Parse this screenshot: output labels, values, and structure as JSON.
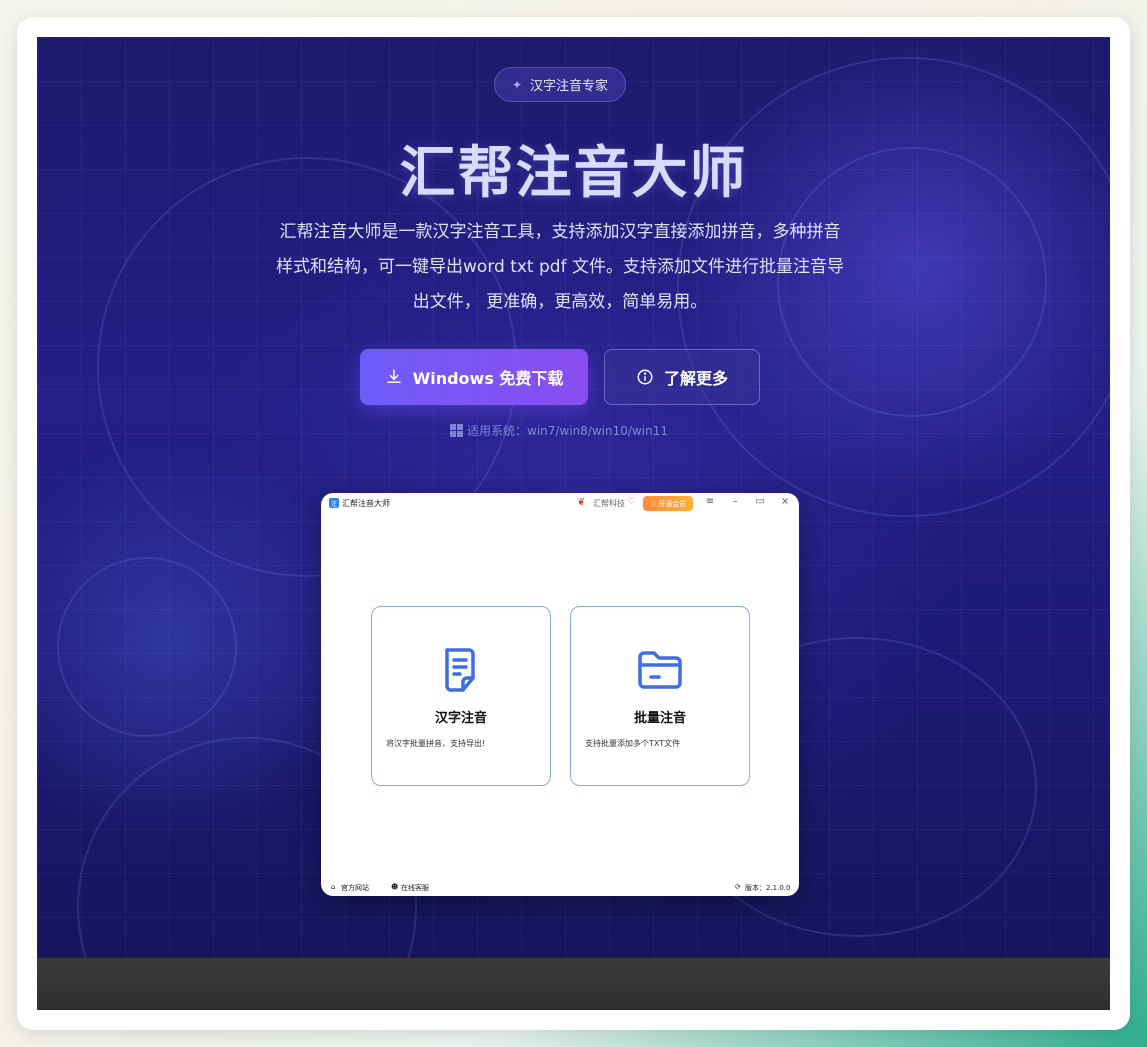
{
  "hero": {
    "tag": "汉字注音专家",
    "title": "汇帮注音大师",
    "description": "汇帮注音大师是一款汉字注音工具，支持添加汉字直接添加拼音，多种拼音样式和结构，可一键导出word txt pdf 文件。支持添加文件进行批量注音导出文件， 更准确，更高效，简单易用。",
    "download_label": "Windows 免费下载",
    "more_label": "了解更多",
    "system_label": "适用系统：win7/win8/win10/win11"
  },
  "app": {
    "name": "汇帮注音大师",
    "logo_text": "注",
    "brand": "汇帮科技",
    "vip_label": "开通会员",
    "cards": [
      {
        "title": "汉字注音",
        "desc": "将汉字批量拼音，支持导出!"
      },
      {
        "title": "批量注音",
        "desc": "支持批量添加多个TXT文件"
      }
    ],
    "status": {
      "website": "官方网站",
      "service": "在线客服",
      "version": "版本：2.1.0.0"
    }
  },
  "colors": {
    "accent": "#6e5cf8",
    "hero_bg": "#231f86",
    "card_border": "#8ea6e6",
    "icon_blue": "#3d6fe0"
  }
}
